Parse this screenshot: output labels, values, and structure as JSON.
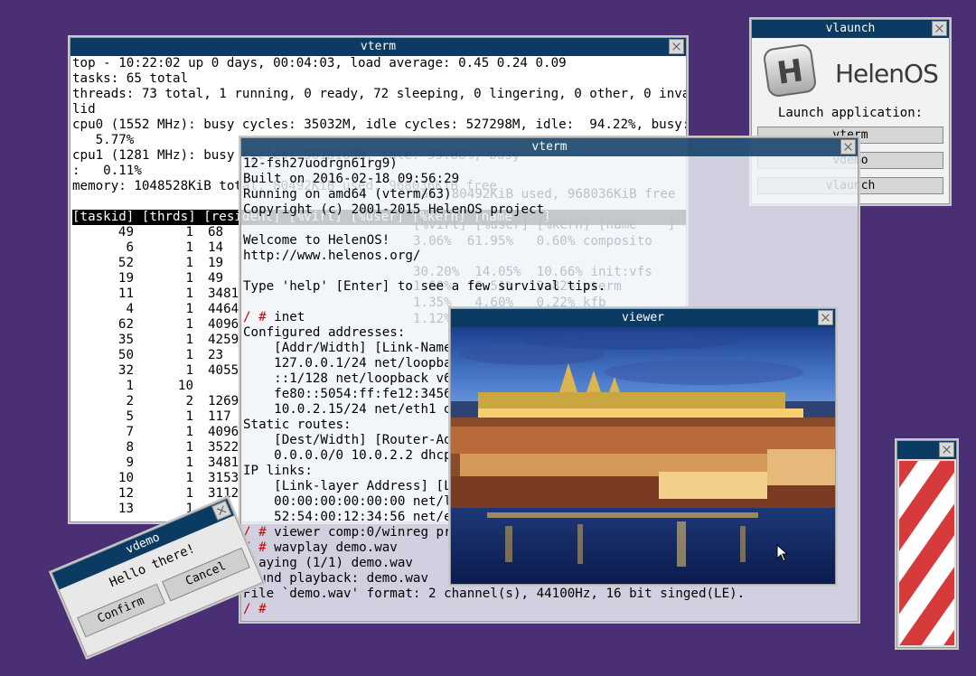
{
  "vterm1": {
    "title": "vterm",
    "lines": [
      "top - 10:22:02 up 0 days, 00:04:03, load average: 0.45 0.24 0.09",
      "tasks: 65 total",
      "threads: 73 total, 1 running, 0 ready, 72 sleeping, 0 lingering, 0 other, 0 inva",
      "lid",
      "cpu0 (1552 MHz): busy cycles: 35032M, idle cycles: 527298M, idle:  94.22%, busy:",
      "   5.77%",
      "cpu1 (1281 MHz): busy cycles: 5613180M, idle: 99.88%, busy",
      ":   0.11%",
      "memory: 1048528KiB total, 80492KiB used, 968036KiB free",
      ""
    ],
    "table_header": "[taskid] [thrds] [resident] [%virt] [%user] [%kern] [name    ]",
    "rows": [
      [
        "49",
        "1",
        "68"
      ],
      [
        "6",
        "1",
        "14"
      ],
      [
        "52",
        "1",
        "19"
      ],
      [
        "19",
        "1",
        "49"
      ],
      [
        "11",
        "1",
        "3481"
      ],
      [
        "4",
        "1",
        "4464"
      ],
      [
        "62",
        "1",
        "4096"
      ],
      [
        "35",
        "1",
        "4259"
      ],
      [
        "50",
        "1",
        "23"
      ],
      [
        "32",
        "1",
        "4055"
      ],
      [
        "1",
        "10",
        ""
      ],
      [
        "2",
        "2",
        "1269"
      ],
      [
        "5",
        "1",
        "117"
      ],
      [
        "7",
        "1",
        "4096"
      ],
      [
        "8",
        "1",
        "3522"
      ],
      [
        "9",
        "1",
        "3481"
      ],
      [
        "10",
        "1",
        "3153"
      ],
      [
        "12",
        "1",
        "3112"
      ],
      [
        "13",
        "1",
        ""
      ]
    ]
  },
  "vterm2": {
    "title": "vterm",
    "lines": [
      "12-fsh27uodrgn61rg9)",
      "Built on 2016-02-18 09:56:29",
      "Running on amd64 (vterm/63)",
      "Copyright (c) 2001-2015 HelenOS project",
      "",
      "Welcome to HelenOS!",
      "http://www.helenos.org/",
      "",
      "Type 'help' [Enter] to see a few survival tips.",
      "",
      "",
      "Configured addresses:",
      "    [Addr/Width] [Link-Name]",
      "    127.0.0.1/24 net/loopback",
      "    ::1/128 net/loopback v6",
      "    fe80::5054:ff:fe12:3456",
      "    10.0.2.15/24 net/eth1 dhcp",
      "Static routes:",
      "    [Dest/Width] [Router-Addr]",
      "    0.0.0.0/0 10.0.2.2 dhcp",
      "IP links:",
      "    [Link-layer Address] [Link-Name]",
      "    00:00:00:00:00:00 net/loopback",
      "    52:54:00:12:34:56 net/eth1",
      "",
      "",
      "Playing (1/1) demo.wav",
      "Hound playback: demo.wav",
      "File `demo.wav' format: 2 channel(s), 44100Hz, 16 bit singed(LE).",
      ""
    ],
    "prompt": "/ #",
    "cmd_inet": "inet",
    "cmd_viewer": "viewer comp:0/winreg prague.tga",
    "cmd_wavplay": "wavplay demo.wav",
    "ghost_lines": [
      "tal, 80492KiB used, 968036KiB free",
      "[%virt] [%user] [%kern] [name    ]",
      "3.06%  61.95%   0.60% composito",
      "30.20%  14.05%  10.66% init:vfs",
      "1.60%  10.51%  13.82% vterm",
      "1.35%   4.60%   0.22% kfb",
      "1.12%   2.57%  24.39% locfs"
    ]
  },
  "viewer": {
    "title": "viewer"
  },
  "vlaunch": {
    "title": "vlaunch",
    "logo_text": "HelenOS",
    "logo_letter": "H",
    "prompt": "Launch application:",
    "buttons": [
      "vterm",
      "vdemo",
      "vlaunch"
    ]
  },
  "vdemo": {
    "title": "vdemo",
    "message": "Hello there!",
    "confirm": "Confirm",
    "cancel": "Cancel"
  },
  "colors": {
    "desktop": "#4a2f74",
    "titlebar": "#0b3a63",
    "prompt": "#cc0000"
  }
}
